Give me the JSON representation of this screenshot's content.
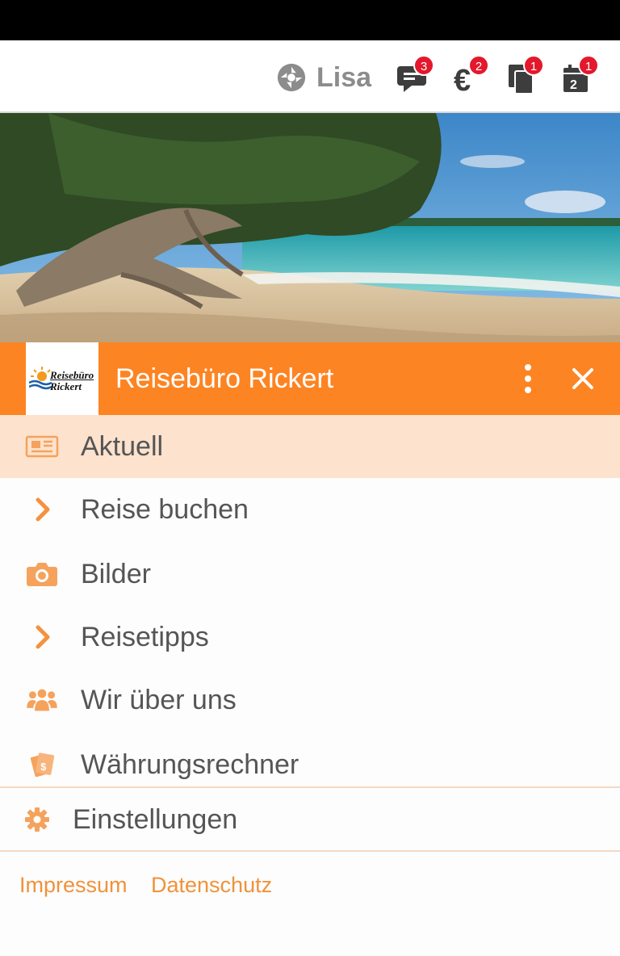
{
  "top_bar": {
    "user_name": "Lisa",
    "icons": [
      {
        "name": "chat-icon",
        "badge": "3"
      },
      {
        "name": "euro-icon",
        "badge": "2"
      },
      {
        "name": "documents-icon",
        "badge": "1"
      },
      {
        "name": "calendar-icon",
        "badge": "1"
      }
    ]
  },
  "header": {
    "logo_line1": "Reisebüro",
    "logo_line2": "Rickert",
    "title": "Reisebüro Rickert"
  },
  "menu": {
    "items": [
      {
        "label": "Aktuell",
        "icon": "newspaper-icon",
        "active": true
      },
      {
        "label": "Reise buchen",
        "icon": "chevron-right-icon"
      },
      {
        "label": "Bilder",
        "icon": "camera-icon"
      },
      {
        "label": "Reisetipps",
        "icon": "chevron-right-icon"
      },
      {
        "label": "Wir über uns",
        "icon": "users-icon"
      },
      {
        "label": "Währungsrechner",
        "icon": "money-icon"
      }
    ],
    "settings_label": "Einstellungen"
  },
  "footer": {
    "impressum": "Impressum",
    "datenschutz": "Datenschutz"
  },
  "colors": {
    "accent": "#fd8422",
    "active_bg": "#fde2cd",
    "badge": "#e3182d",
    "link": "#f0923b",
    "icon": "#f5a25d"
  }
}
